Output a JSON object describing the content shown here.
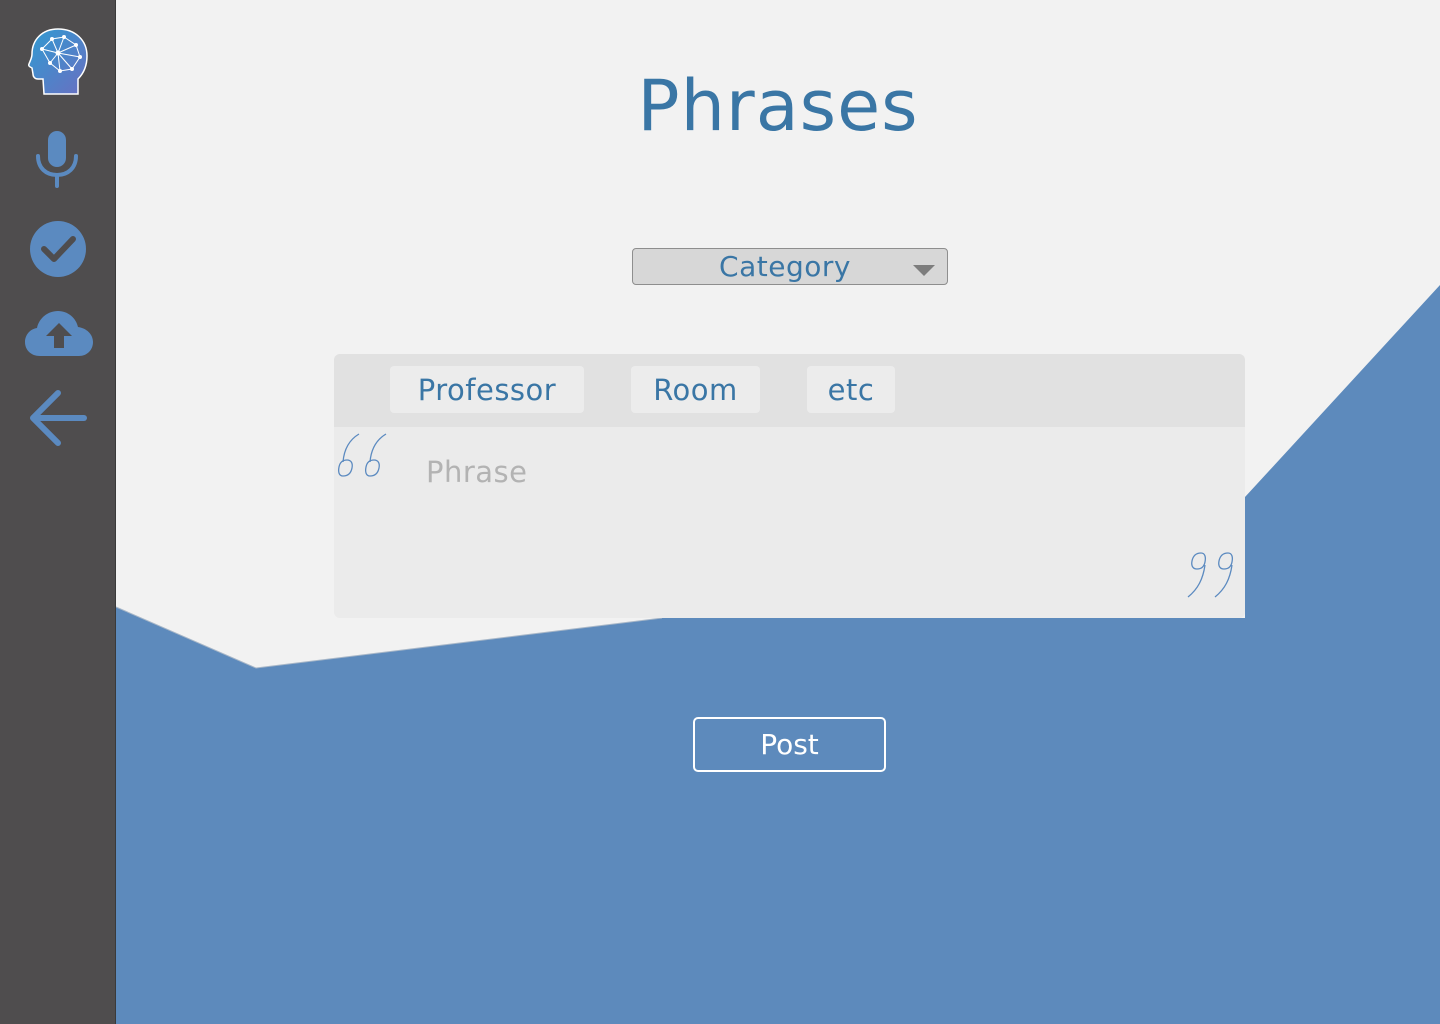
{
  "page": {
    "title": "Phrases"
  },
  "category": {
    "selected": "Category"
  },
  "tags": [
    "Professor",
    "Room",
    "etc"
  ],
  "phrase": {
    "placeholder": "Phrase",
    "value": ""
  },
  "actions": {
    "post_label": "Post"
  },
  "sidebar": {
    "items": [
      {
        "icon": "brain-logo-icon"
      },
      {
        "icon": "microphone-icon"
      },
      {
        "icon": "checkmark-circle-icon"
      },
      {
        "icon": "cloud-upload-icon"
      },
      {
        "icon": "back-arrow-icon"
      }
    ]
  },
  "colors": {
    "accent": "#3a76a5",
    "icon_blue": "#5b8ac0",
    "wave_blue": "#5d8abc",
    "sidebar": "#4f4d4e",
    "background": "#f2f2f2",
    "card": "#ebebeb",
    "tag_bar": "#e1e1e1"
  }
}
